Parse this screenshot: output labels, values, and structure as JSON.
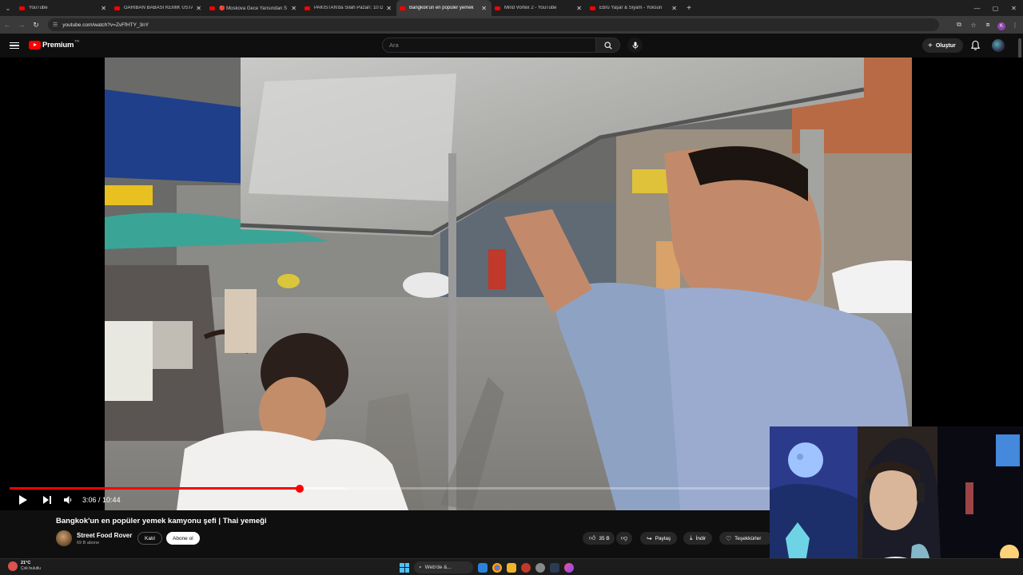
{
  "browser": {
    "tabs": [
      {
        "title": "YouTube",
        "active": false
      },
      {
        "title": "GARİBAN BABASI KEMİK USTAS",
        "active": false
      },
      {
        "title": "🔴 Moskova Gece Yarısından S",
        "active": false
      },
      {
        "title": "PAKİSTAN'da Silah Pazarı: 10 D",
        "active": false
      },
      {
        "title": "Bangkok'un en popüler yemek",
        "active": true
      },
      {
        "title": "Mind Vortex 2 - YouTube",
        "active": false
      },
      {
        "title": "Ebru Yaşar & Siyam - Yoksun",
        "active": false
      }
    ],
    "url": "youtube.com/watch?v=ZvFfHTY_3nY",
    "profile_initial": "K"
  },
  "youtube": {
    "logo_text": "Premium",
    "logo_region": "TR",
    "search_placeholder": "Ara",
    "create_label": "Oluştur"
  },
  "player": {
    "current_time": "3:06",
    "duration": "10:44",
    "progress_fraction": 0.289,
    "buffered_fraction": 0.335,
    "accent": "#ff0000"
  },
  "video_info": {
    "title": "Bangkok'un en popüler yemek kamyonu şefi | Thai yemeği",
    "channel": "Street Food Rover",
    "subscribers": "69 B abone",
    "join_label": "Katıl",
    "subscribe_label": "Abone ol",
    "likes": "35 B",
    "share_label": "Paylaş",
    "download_label": "İndir",
    "thanks_label": "Teşekkürler"
  },
  "taskbar": {
    "temperature": "21°C",
    "weather": "Çok bulutlu",
    "search_label": "Web'de &..."
  }
}
